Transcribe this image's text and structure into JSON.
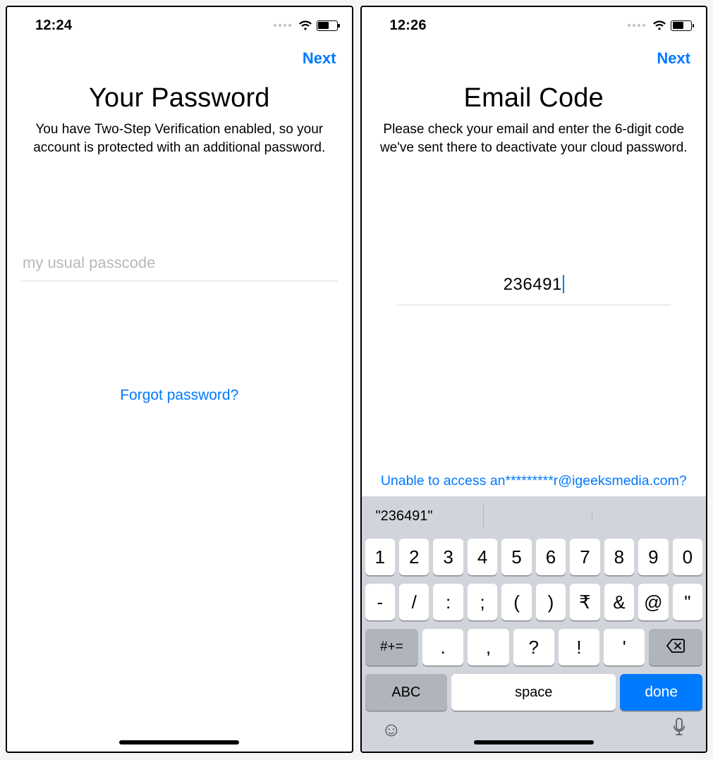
{
  "left": {
    "status": {
      "time": "12:24",
      "battery_pct": 55
    },
    "nav": {
      "next": "Next"
    },
    "title": "Your Password",
    "subtitle": "You have Two-Step Verification enabled, so your account is protected with an additional password.",
    "input": {
      "placeholder": "my usual passcode",
      "value": ""
    },
    "forgot_link": "Forgot password?"
  },
  "right": {
    "status": {
      "time": "12:26",
      "battery_pct": 55
    },
    "nav": {
      "next": "Next"
    },
    "title": "Email Code",
    "subtitle": "Please check your email and enter the 6-digit code we've sent there to deactivate your cloud password.",
    "input": {
      "value": "236491"
    },
    "access_link": "Unable to access an*********r@igeeksmedia.com?",
    "keyboard": {
      "suggestion": "\"236491\"",
      "row1": [
        "1",
        "2",
        "3",
        "4",
        "5",
        "6",
        "7",
        "8",
        "9",
        "0"
      ],
      "row2": [
        "-",
        "/",
        ":",
        ";",
        "(",
        ")",
        "₹",
        "&",
        "@",
        "\""
      ],
      "row3_mod": "#+=",
      "row3": [
        ".",
        ",",
        "?",
        "!",
        "'"
      ],
      "row4": {
        "abc": "ABC",
        "space": "space",
        "done": "done"
      }
    }
  }
}
